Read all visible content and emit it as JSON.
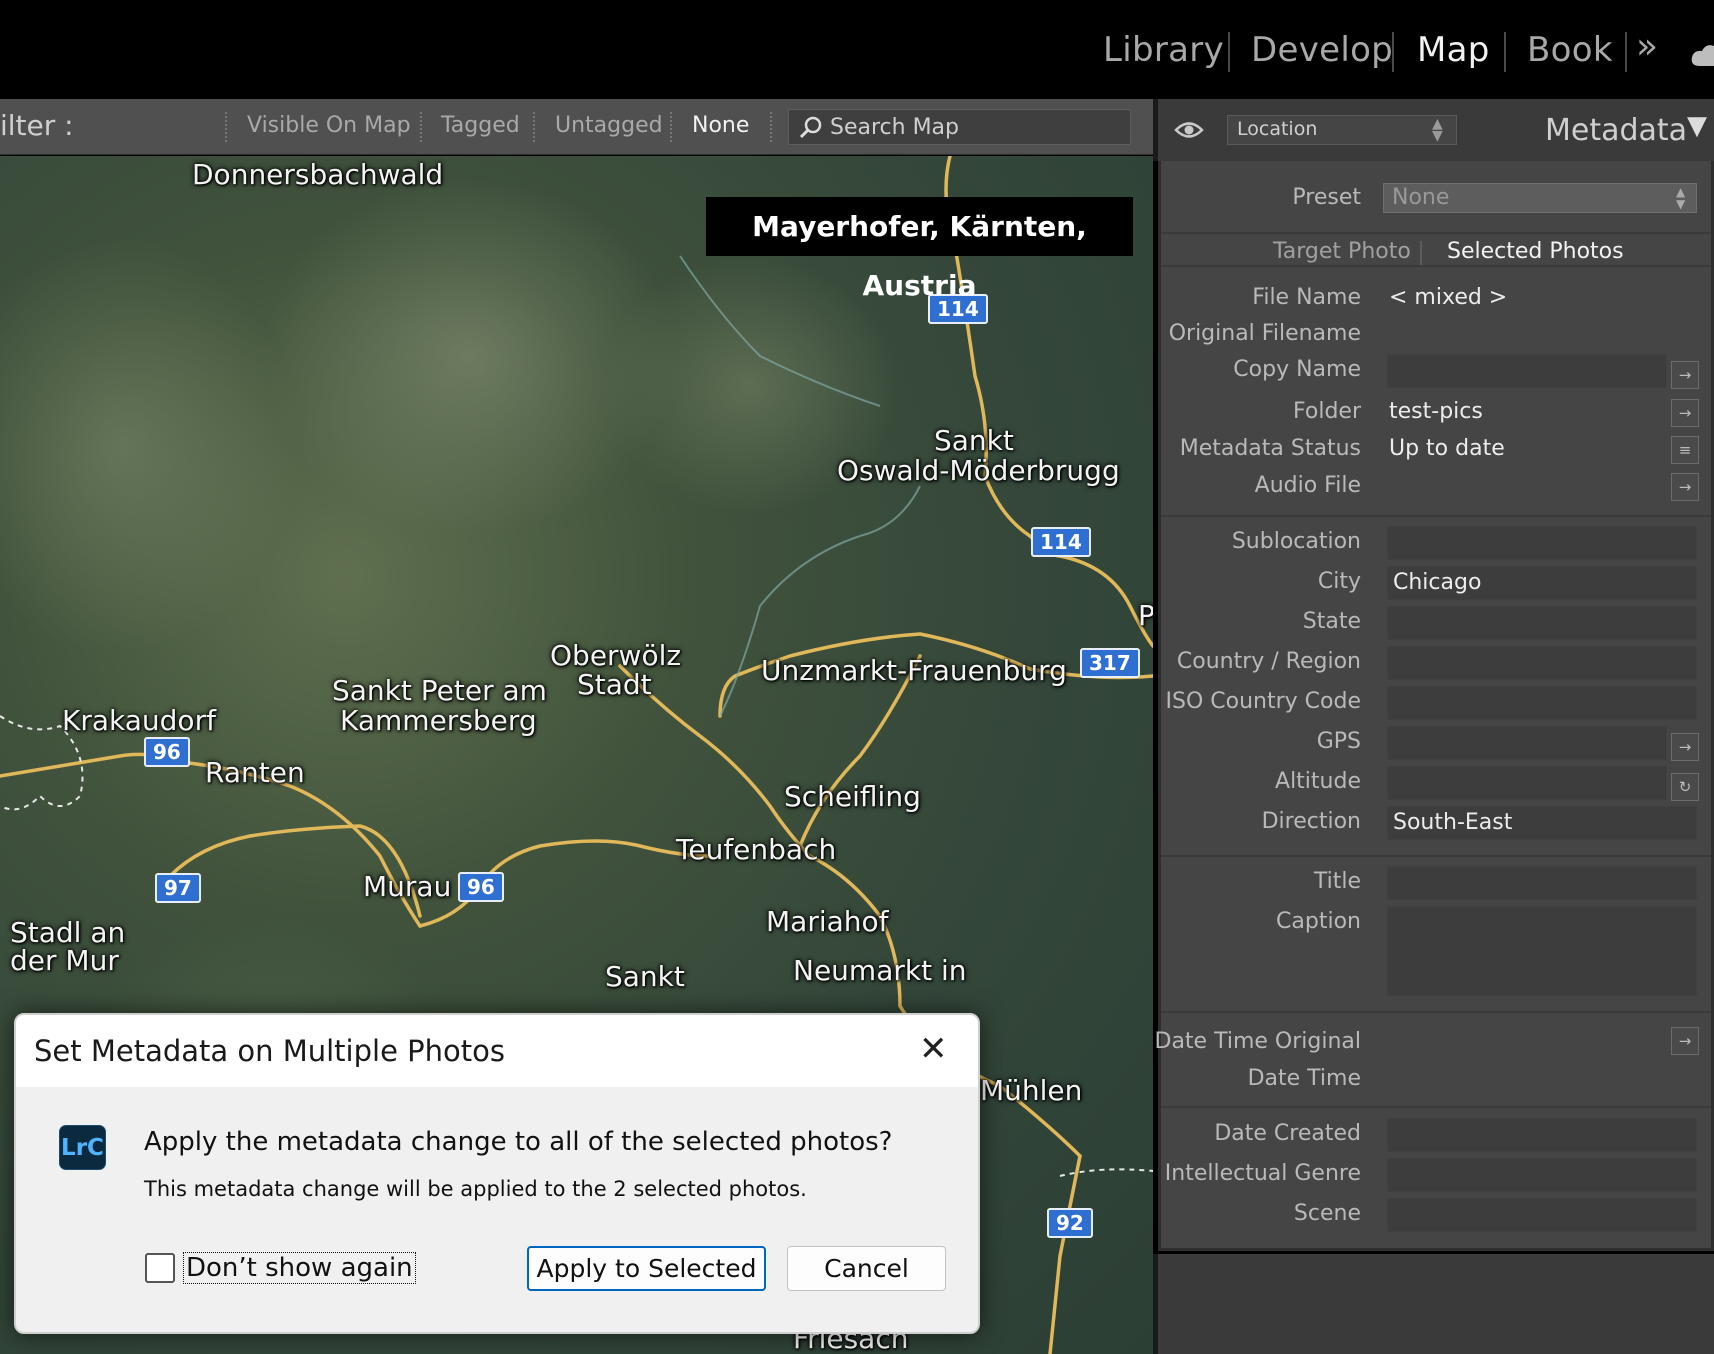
{
  "modules": {
    "library": "Library",
    "develop": "Develop",
    "map": "Map",
    "book": "Book",
    "more": "»"
  },
  "filterbar": {
    "label": "ilter :",
    "visible_on_map": "Visible On Map",
    "tagged": "Tagged",
    "untagged": "Untagged",
    "none": "None",
    "search_placeholder": "Search Map"
  },
  "map": {
    "location_badge": "Mayerhofer, Kärnten, Austria",
    "places": {
      "donnersbachwald": "Donnersbachwald",
      "sankt_oswald_1": "Sankt",
      "sankt_oswald_2": "Oswald-Möderbrugg",
      "oberwolz_1": "Oberwölz",
      "oberwolz_2": "Stadt",
      "sankt_peter_1": "Sankt Peter am",
      "sankt_peter_2": "Kammersberg",
      "krakaudorf": "Krakaudorf",
      "ranten": "Ranten",
      "unzmarkt": "Unzmarkt-Frauenburg",
      "scheifling": "Scheifling",
      "teufenbach": "Teufenbach",
      "murau": "Murau",
      "stadl_1": "Stadl an",
      "stadl_2": "der Mur",
      "mariahof": "Mariahof",
      "sankt": "Sankt",
      "neumarkt": "Neumarkt in",
      "muhlen": "Mühlen",
      "friesach": "Friesach",
      "edge_p": "P"
    },
    "roads": {
      "r114a": "114",
      "r114b": "114",
      "r317": "317",
      "r96a": "96",
      "r96b": "96",
      "r97": "97",
      "r92": "92"
    }
  },
  "panel": {
    "section_select": "Location",
    "title": "Metadata",
    "preset_label": "Preset",
    "preset_value": "None",
    "tab_target": "Target Photo",
    "tab_selected": "Selected Photos",
    "rows": {
      "file_name_label": "File Name",
      "file_name_value": "< mixed >",
      "original_filename_label": "Original Filename",
      "copy_name_label": "Copy Name",
      "folder_label": "Folder",
      "folder_value": "test-pics",
      "metadata_status_label": "Metadata Status",
      "metadata_status_value": "Up to date",
      "audio_file_label": "Audio File",
      "sublocation_label": "Sublocation",
      "city_label": "City",
      "city_value": "Chicago",
      "state_label": "State",
      "country_label": "Country / Region",
      "iso_label": "ISO Country Code",
      "gps_label": "GPS",
      "altitude_label": "Altitude",
      "direction_label": "Direction",
      "direction_value": "South-East",
      "title_label": "Title",
      "caption_label": "Caption",
      "date_time_original_label": "Date Time Original",
      "date_time_label": "Date Time",
      "date_created_label": "Date Created",
      "intellectual_genre_label": "Intellectual Genre",
      "scene_label": "Scene"
    }
  },
  "dialog": {
    "title": "Set Metadata on Multiple Photos",
    "logo": "LrC",
    "message": "Apply the metadata change to all of the selected photos?",
    "detail": "This metadata change will be applied to the 2 selected photos.",
    "checkbox_label": "Don’t show again",
    "apply_button": "Apply to Selected",
    "cancel_button": "Cancel",
    "close": "✕"
  }
}
